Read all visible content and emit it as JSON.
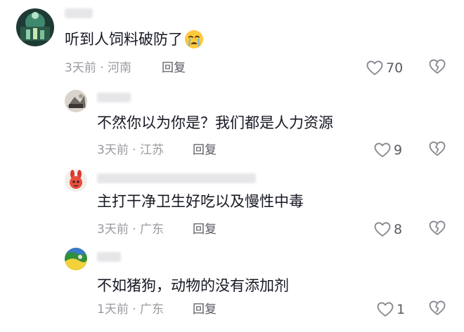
{
  "comments": [
    {
      "text": "听到人饲料破防了",
      "emoji": "crying-face-emoji",
      "meta": "3天前 · 河南",
      "reply_label": "回复",
      "likes": "70"
    },
    {
      "text": "不然你以为你是？我们都是人力资源",
      "meta": "3天前 · 江苏",
      "reply_label": "回复",
      "likes": "9"
    },
    {
      "text": "主打干净卫生好吃以及慢性中毒",
      "meta": "3天前 · 广东",
      "reply_label": "回复",
      "likes": "8"
    },
    {
      "text": "不如猪狗，动物的没有添加剂",
      "meta": "1天前 · 广东",
      "reply_label": "回复",
      "likes": "1"
    }
  ],
  "colors": {
    "text": "#161823",
    "meta": "#9a9aa0",
    "action": "#5a5a63",
    "icon": "#8a8a92"
  },
  "icons": {
    "like": "heart-outline-icon",
    "dislike": "broken-heart-outline-icon"
  }
}
